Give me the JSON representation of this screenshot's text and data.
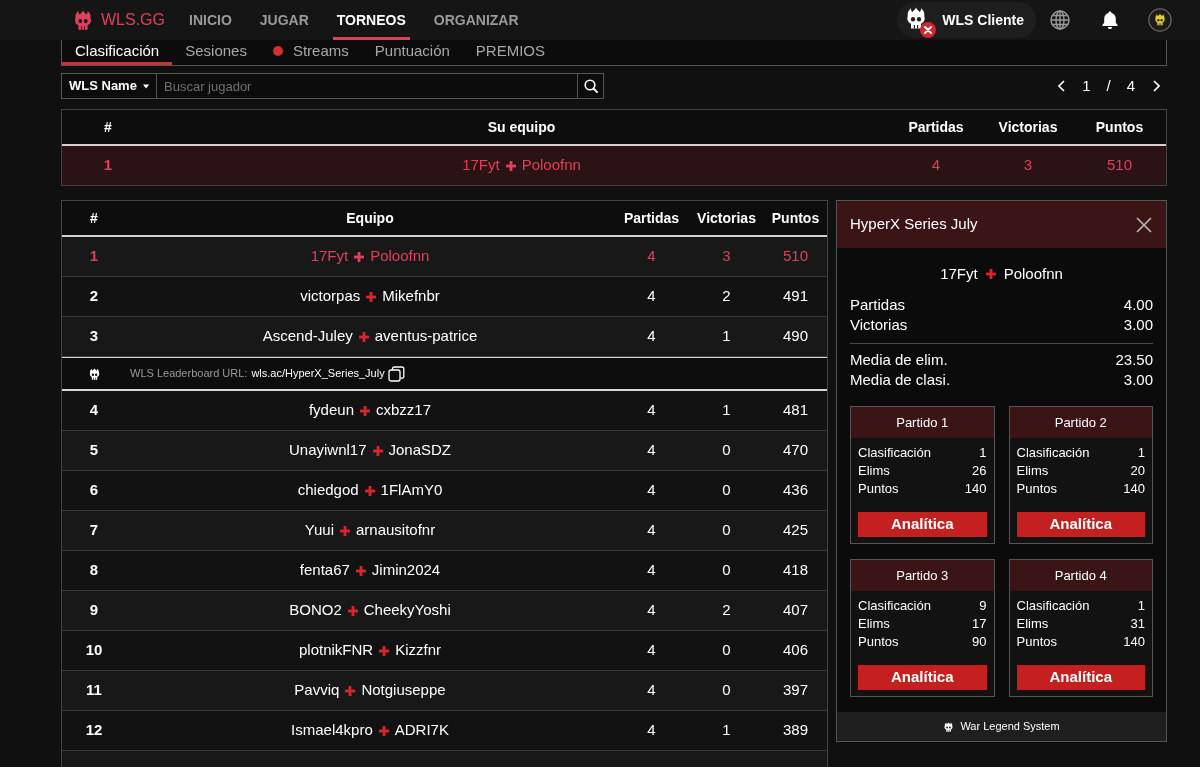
{
  "nav": {
    "brand": "WLS.GG",
    "links": [
      {
        "label": "INICIO",
        "selected": false
      },
      {
        "label": "JUGAR",
        "selected": false
      },
      {
        "label": "TORNEOS",
        "selected": true
      },
      {
        "label": "ORGANIZAR",
        "selected": false
      }
    ],
    "client_button": "WLS Cliente"
  },
  "subtabs": [
    {
      "label": "Clasificación",
      "selected": true,
      "live": false
    },
    {
      "label": "Sesiones",
      "selected": false,
      "live": false
    },
    {
      "label": "Streams",
      "selected": false,
      "live": true
    },
    {
      "label": "Puntuación",
      "selected": false,
      "live": false
    },
    {
      "label": "PREMIOS",
      "selected": false,
      "live": false
    }
  ],
  "search": {
    "filter": "WLS Name",
    "placeholder": "Buscar jugador"
  },
  "pagination": {
    "page": "1",
    "separator": "/",
    "total": "4"
  },
  "my_team": {
    "columns": [
      "#",
      "Su equipo",
      "Partidas",
      "Victorias",
      "Puntos"
    ],
    "rows": [
      {
        "rank": "1",
        "players": [
          "17Fyt",
          "Poloofnn"
        ],
        "partidas": "4",
        "victorias": "3",
        "puntos": "510",
        "highlighted": true
      }
    ]
  },
  "standings": {
    "columns": [
      "#",
      "Equipo",
      "Partidas",
      "Victorias",
      "Puntos"
    ],
    "rows": [
      {
        "kind": "team",
        "rank": "1",
        "players": [
          "17Fyt",
          "Poloofnn"
        ],
        "partidas": "4",
        "victorias": "3",
        "puntos": "510",
        "highlighted": true
      },
      {
        "kind": "team",
        "rank": "2",
        "players": [
          "victorpas",
          "Mikefnbr"
        ],
        "partidas": "4",
        "victorias": "2",
        "puntos": "491",
        "highlighted": false
      },
      {
        "kind": "team",
        "rank": "3",
        "players": [
          "Ascend-Juley",
          "aventus-patrice"
        ],
        "partidas": "4",
        "victorias": "1",
        "puntos": "490",
        "highlighted": false
      },
      {
        "kind": "link",
        "label": "WLS Leaderboard URL:",
        "url": "wls.ac/HyperX_Series_July"
      },
      {
        "kind": "team",
        "rank": "4",
        "players": [
          "fydeun",
          "cxbzz17"
        ],
        "partidas": "4",
        "victorias": "1",
        "puntos": "481",
        "highlighted": false
      },
      {
        "kind": "team",
        "rank": "5",
        "players": [
          "Unayiwnl17",
          "JonaSDZ"
        ],
        "partidas": "4",
        "victorias": "0",
        "puntos": "470",
        "highlighted": false
      },
      {
        "kind": "team",
        "rank": "6",
        "players": [
          "chiedgod",
          "1FlAmY0"
        ],
        "partidas": "4",
        "victorias": "0",
        "puntos": "436",
        "highlighted": false
      },
      {
        "kind": "team",
        "rank": "7",
        "players": [
          "Yuui",
          "arnausitofnr"
        ],
        "partidas": "4",
        "victorias": "0",
        "puntos": "425",
        "highlighted": false
      },
      {
        "kind": "team",
        "rank": "8",
        "players": [
          "fenta67",
          "Jimin2024"
        ],
        "partidas": "4",
        "victorias": "0",
        "puntos": "418",
        "highlighted": false
      },
      {
        "kind": "team",
        "rank": "9",
        "players": [
          "BONO2",
          "CheekyYoshi"
        ],
        "partidas": "4",
        "victorias": "2",
        "puntos": "407",
        "highlighted": false
      },
      {
        "kind": "team",
        "rank": "10",
        "players": [
          "plotnikFNR",
          "Kizzfnr"
        ],
        "partidas": "4",
        "victorias": "0",
        "puntos": "406",
        "highlighted": false
      },
      {
        "kind": "team",
        "rank": "11",
        "players": [
          "Pavviq",
          "Notgiuseppe"
        ],
        "partidas": "4",
        "victorias": "0",
        "puntos": "397",
        "highlighted": false
      },
      {
        "kind": "team",
        "rank": "12",
        "players": [
          "Ismael4kpro",
          "ADRI7K"
        ],
        "partidas": "4",
        "victorias": "1",
        "puntos": "389",
        "highlighted": false
      }
    ]
  },
  "detail_panel": {
    "title": "HyperX Series July",
    "players": [
      "17Fyt",
      "Poloofnn"
    ],
    "stat_groups": [
      [
        {
          "label": "Partidas",
          "value": "4.00"
        },
        {
          "label": "Victorias",
          "value": "3.00"
        }
      ],
      [
        {
          "label": "Media de elim.",
          "value": "23.50"
        },
        {
          "label": "Media de clasi.",
          "value": "3.00"
        }
      ]
    ],
    "matches": [
      {
        "title": "Partido 1",
        "stats": [
          {
            "label": "Clasificación",
            "value": "1"
          },
          {
            "label": "Elims",
            "value": "26"
          },
          {
            "label": "Puntos",
            "value": "140"
          }
        ],
        "button": "Analítica"
      },
      {
        "title": "Partido 2",
        "stats": [
          {
            "label": "Clasificación",
            "value": "1"
          },
          {
            "label": "Elims",
            "value": "20"
          },
          {
            "label": "Puntos",
            "value": "140"
          }
        ],
        "button": "Analítica"
      },
      {
        "title": "Partido 3",
        "stats": [
          {
            "label": "Clasificación",
            "value": "9"
          },
          {
            "label": "Elims",
            "value": "17"
          },
          {
            "label": "Puntos",
            "value": "90"
          }
        ],
        "button": "Analítica"
      },
      {
        "title": "Partido 4",
        "stats": [
          {
            "label": "Clasificación",
            "value": "1"
          },
          {
            "label": "Elims",
            "value": "31"
          },
          {
            "label": "Puntos",
            "value": "140"
          }
        ],
        "button": "Analítica"
      }
    ],
    "footer": "War Legend System"
  }
}
